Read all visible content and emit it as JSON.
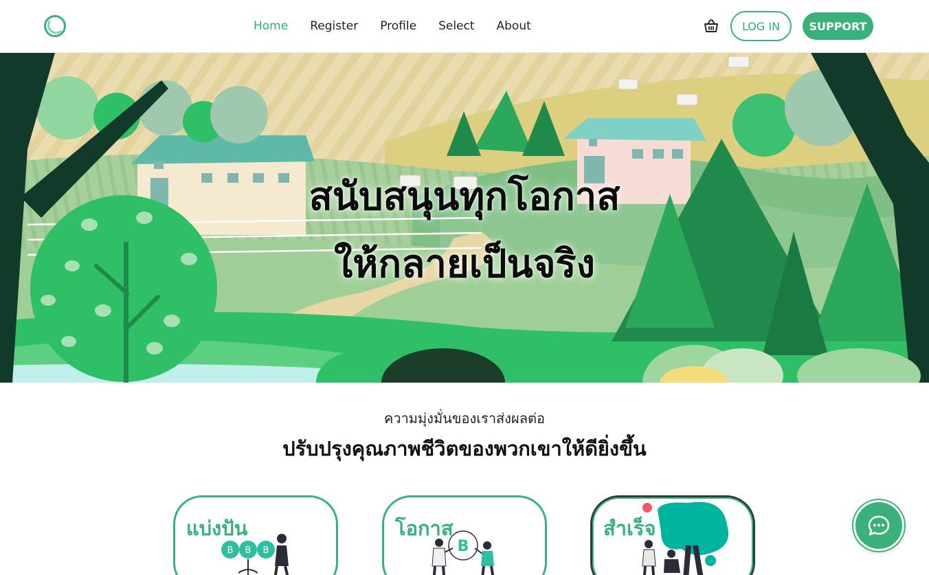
{
  "header": {
    "logo_icon": "ring-logo-icon",
    "nav": [
      {
        "label": "Home",
        "active": true
      },
      {
        "label": "Register",
        "active": false
      },
      {
        "label": "Profile",
        "active": false
      },
      {
        "label": "Select",
        "active": false
      },
      {
        "label": "About",
        "active": false
      }
    ],
    "cart_icon": "shopping-basket-icon",
    "login_label": "LOG IN",
    "support_label": "SUPPORT"
  },
  "hero": {
    "line1": "สนับสนุนทุกโอกาส",
    "line2": "ให้กลายเป็นจริง"
  },
  "mission": {
    "subtitle": "ความมุ่งมั่นของเราส่งผลต่อ",
    "title": "ปรับปรุงคุณภาพชีวิตของพวกเขาให้ดียิ่งขึ้น"
  },
  "cards": [
    {
      "label": "แบ่งปัน"
    },
    {
      "label": "โอกาส"
    },
    {
      "label": "สำเร็จ"
    }
  ],
  "chat": {
    "icon": "chat-bubble-icon"
  },
  "colors": {
    "accent": "#3ab07b",
    "accent_text": "#2fae73",
    "dark_border": "#2f3d3a"
  }
}
